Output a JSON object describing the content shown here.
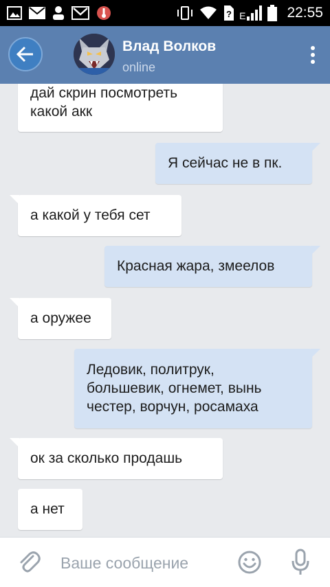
{
  "status_bar": {
    "time": "22:55",
    "network_label": "E",
    "icons": [
      "gallery-icon",
      "mail-icon",
      "person-icon",
      "gmail-icon",
      "temperature-icon",
      "vibrate-icon",
      "wifi-icon",
      "sim-unknown-icon",
      "signal-icon",
      "battery-icon"
    ]
  },
  "header": {
    "back_icon": "back-arrow-icon",
    "contact_name": "Влад Волков",
    "contact_status": "online",
    "menu_icon": "more-vertical-icon"
  },
  "messages": [
    {
      "side": "in",
      "text": "дай скрин посмотреть\nкакой акк"
    },
    {
      "side": "out",
      "text": "Я сейчас не в пк."
    },
    {
      "side": "in",
      "text": "а какой у тебя сет"
    },
    {
      "side": "out",
      "text": "Красная жара, змеелов"
    },
    {
      "side": "in",
      "text": "а оружее"
    },
    {
      "side": "out",
      "text": "Ледовик, политрук,\nбольшевик, огнемет, вынь\nчестер, ворчун, росамаха"
    },
    {
      "side": "in",
      "text": "ок за сколько продашь"
    },
    {
      "side": "in",
      "text": "а нет"
    }
  ],
  "composer": {
    "placeholder": "Ваше сообщение",
    "attach_icon": "paperclip-icon",
    "emoji_icon": "emoji-icon",
    "mic_icon": "microphone-icon"
  },
  "colors": {
    "header_bg": "#5b80b0",
    "chat_bg": "#e8eaed",
    "incoming_bubble": "#ffffff",
    "outgoing_bubble": "#d4e2f4"
  }
}
